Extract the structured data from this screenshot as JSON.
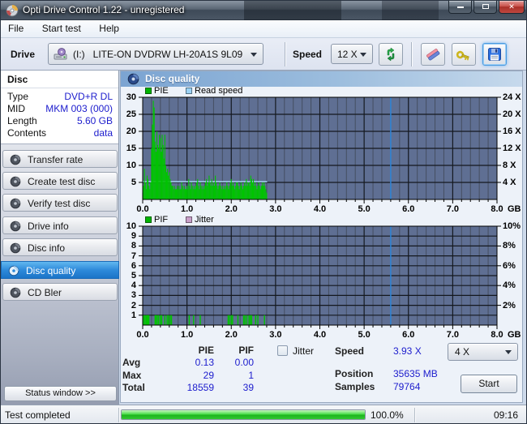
{
  "window": {
    "title": "Opti Drive Control 1.22 - unregistered"
  },
  "menu": {
    "items": [
      "File",
      "Start test",
      "Help"
    ]
  },
  "toolbar": {
    "drive_label": "Drive",
    "drive_value": "(I:)   LITE-ON DVDRW LH-20A1S 9L09",
    "speed_label": "Speed",
    "speed_value": "12 X"
  },
  "sidebar": {
    "disc": {
      "title": "Disc",
      "rows": [
        {
          "label": "Type",
          "value": "DVD+R DL"
        },
        {
          "label": "MID",
          "value": "MKM 003 (000)"
        },
        {
          "label": "Length",
          "value": "5.60 GB"
        },
        {
          "label": "Contents",
          "value": "data"
        }
      ]
    },
    "buttons": [
      {
        "label": "Transfer rate",
        "selected": false
      },
      {
        "label": "Create test disc",
        "selected": false
      },
      {
        "label": "Verify test disc",
        "selected": false
      },
      {
        "label": "Drive info",
        "selected": false
      },
      {
        "label": "Disc info",
        "selected": false
      },
      {
        "label": "Disc quality",
        "selected": true
      },
      {
        "label": "CD Bler",
        "selected": false
      }
    ],
    "status_window_label": "Status window >>"
  },
  "main_header": "Disc quality",
  "chart_data": [
    {
      "type": "bar",
      "name": "pie-read-speed-chart",
      "legend": [
        {
          "label": "PIE",
          "color": "#00b400"
        },
        {
          "label": "Read speed",
          "color": "#9cd2f4"
        }
      ],
      "xlim": [
        0,
        8
      ],
      "ylim": [
        0,
        30
      ],
      "x_tick_labels": [
        "0.0",
        "1.0",
        "2.0",
        "3.0",
        "4.0",
        "5.0",
        "6.0",
        "7.0",
        "8.0"
      ],
      "x_unit": "GB",
      "left_ticks": [
        {
          "v": 30,
          "label": "30"
        },
        {
          "v": 25,
          "label": "25"
        },
        {
          "v": 20,
          "label": "20"
        },
        {
          "v": 15,
          "label": "15"
        },
        {
          "v": 10,
          "label": "10"
        },
        {
          "v": 5,
          "label": "5"
        }
      ],
      "right_ticks": [
        {
          "v": 30,
          "label": "24 X"
        },
        {
          "v": 25,
          "label": "20 X"
        },
        {
          "v": 20,
          "label": "16 X"
        },
        {
          "v": 15,
          "label": "12 X"
        },
        {
          "v": 10,
          "label": "8 X"
        },
        {
          "v": 5,
          "label": "4 X"
        }
      ],
      "grid": {
        "x_minor": 0.2,
        "x_major": 1,
        "y_step": 5
      },
      "series": [
        {
          "name": "Read speed",
          "type": "hline",
          "color": "#a8d8f8",
          "y": 5.2,
          "x_from": 0,
          "x_to": 2.81
        },
        {
          "name": "PIE",
          "type": "bars",
          "color": "#00c400",
          "x_start": 0,
          "x_step": 0.02,
          "values": [
            2,
            4,
            9,
            5,
            3,
            7,
            6,
            4,
            3,
            5,
            15,
            22,
            29,
            27,
            17,
            14,
            20,
            16,
            15,
            19,
            18,
            14,
            19,
            16,
            12,
            19,
            10,
            8,
            9,
            7,
            8,
            6,
            5,
            4,
            4,
            3,
            4,
            3,
            3,
            4,
            3,
            4,
            3,
            3,
            5,
            4,
            3,
            4,
            3,
            3,
            4,
            3,
            6,
            4,
            3,
            5,
            4,
            3,
            4,
            3,
            4,
            5,
            6,
            4,
            3,
            5,
            4,
            3,
            4,
            3,
            4,
            5,
            6,
            4,
            5,
            7,
            5,
            4,
            6,
            4,
            5,
            4,
            7,
            5,
            4,
            3,
            4,
            5,
            4,
            3,
            4,
            3,
            4,
            3,
            4,
            5,
            4,
            3,
            4,
            5,
            6,
            4,
            5,
            4,
            3,
            4,
            5,
            5,
            4,
            3,
            4,
            5,
            4,
            3,
            4,
            5,
            4,
            6,
            4,
            5,
            5,
            4,
            7,
            6,
            5,
            6,
            4,
            5,
            4,
            3,
            4,
            5,
            4,
            3,
            4,
            5,
            4,
            5,
            4,
            3,
            2
          ]
        }
      ],
      "cursor": {
        "x": 5.6,
        "color": "#2f84d6"
      }
    },
    {
      "type": "bar",
      "name": "pif-jitter-chart",
      "legend": [
        {
          "label": "PIF",
          "color": "#00b400"
        },
        {
          "label": "Jitter",
          "color": "#c9a0c9"
        }
      ],
      "xlim": [
        0,
        8
      ],
      "ylim": [
        0,
        10
      ],
      "x_tick_labels": [
        "0.0",
        "1.0",
        "2.0",
        "3.0",
        "4.0",
        "5.0",
        "6.0",
        "7.0",
        "8.0"
      ],
      "x_unit": "GB",
      "left_ticks": [
        {
          "v": 10,
          "label": "10"
        },
        {
          "v": 9,
          "label": "9"
        },
        {
          "v": 8,
          "label": "8"
        },
        {
          "v": 7,
          "label": "7"
        },
        {
          "v": 6,
          "label": "6"
        },
        {
          "v": 5,
          "label": "5"
        },
        {
          "v": 4,
          "label": "4"
        },
        {
          "v": 3,
          "label": "3"
        },
        {
          "v": 2,
          "label": "2"
        },
        {
          "v": 1,
          "label": "1"
        }
      ],
      "right_ticks": [
        {
          "v": 10,
          "label": "10%"
        },
        {
          "v": 8,
          "label": "8%"
        },
        {
          "v": 6,
          "label": "6%"
        },
        {
          "v": 4,
          "label": "4%"
        },
        {
          "v": 2,
          "label": "2%"
        }
      ],
      "grid": {
        "x_minor": 0.2,
        "x_major": 1,
        "y_step": 1
      },
      "series": [
        {
          "name": "PIF",
          "type": "spikes",
          "color": "#00c400",
          "height": 1,
          "x": [
            0.02,
            0.05,
            0.08,
            0.1,
            0.12,
            0.14,
            0.28,
            0.3,
            0.33,
            0.36,
            0.4,
            0.43,
            0.5,
            0.55,
            0.58,
            0.62,
            0.65,
            1.05,
            1.15,
            1.3,
            1.93,
            1.96,
            2.0,
            2.03,
            2.15,
            2.28,
            2.31,
            2.35,
            2.4,
            2.43,
            2.46,
            2.55,
            2.6,
            2.75
          ]
        }
      ],
      "cursor": {
        "x": 5.6,
        "color": "#2f84d6"
      }
    }
  ],
  "stats": {
    "columns": [
      "PIE",
      "PIF"
    ],
    "rows": [
      {
        "label": "Avg",
        "pie": "0.13",
        "pif": "0.00"
      },
      {
        "label": "Max",
        "pie": "29",
        "pif": "1"
      },
      {
        "label": "Total",
        "pie": "18559",
        "pif": "39"
      }
    ],
    "jitter_label": "Jitter",
    "jitter_checked": false,
    "speed_label": "Speed",
    "speed_value": "3.93 X",
    "position_label": "Position",
    "position_value": "35635 MB",
    "samples_label": "Samples",
    "samples_value": "79764",
    "write_speed_value": "4 X",
    "start_label": "Start"
  },
  "statusbar": {
    "status": "Test completed",
    "progress_pct": "100.0%",
    "time": "09:16"
  }
}
